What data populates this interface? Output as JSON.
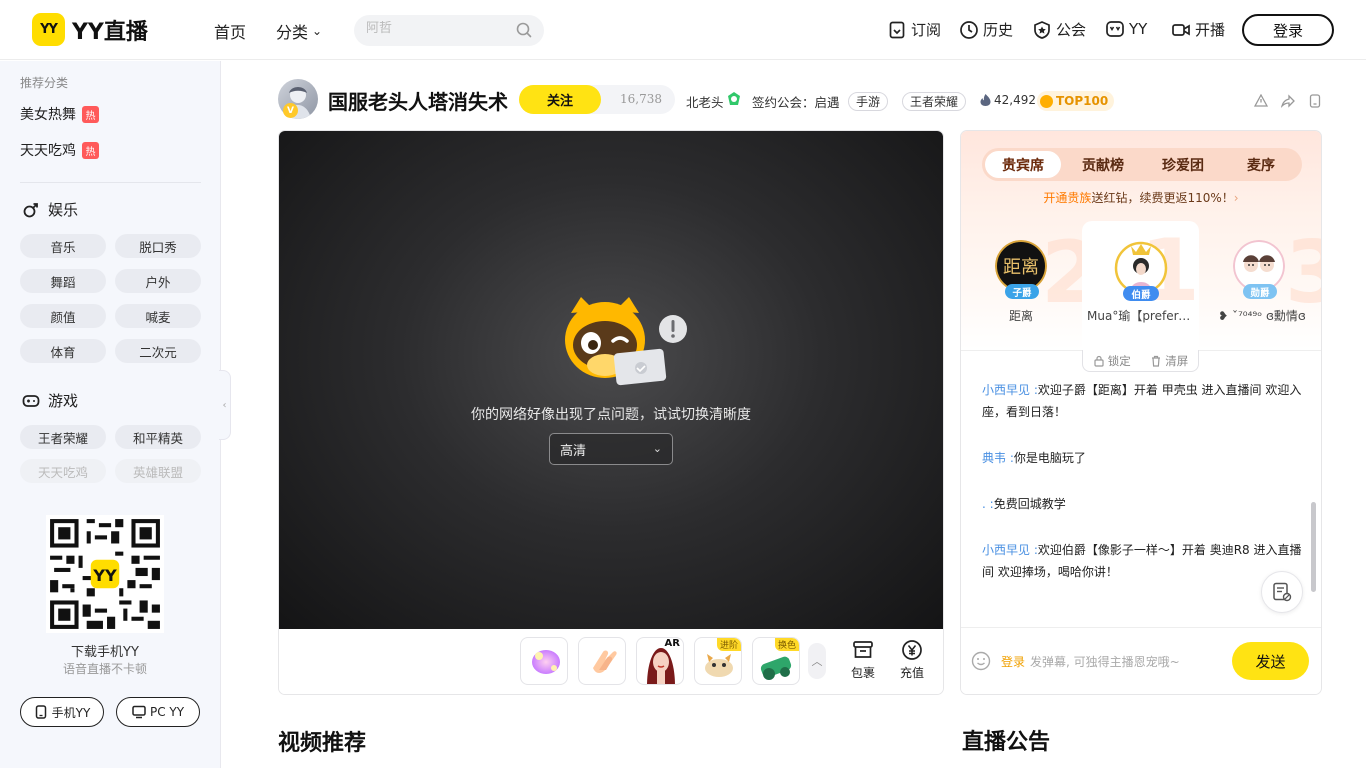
{
  "header": {
    "logo_badge": "YY",
    "logo_text": "YY直播",
    "nav_home": "首页",
    "nav_category": "分类",
    "search_placeholder": "阿哲",
    "right_nav": [
      {
        "label": "订阅",
        "icon": "bookmark-icon"
      },
      {
        "label": "历史",
        "icon": "clock-icon"
      },
      {
        "label": "公会",
        "icon": "star-badge-icon"
      },
      {
        "label": "YY",
        "icon": "yy-face-icon"
      },
      {
        "label": "开播",
        "icon": "video-camera-icon"
      }
    ],
    "login_label": "登录"
  },
  "sidebar": {
    "recommend_title": "推荐分类",
    "hot_items": [
      {
        "label": "美女热舞",
        "tag": "热"
      },
      {
        "label": "天天吃鸡",
        "tag": "热"
      }
    ],
    "sections": [
      {
        "title": "娱乐",
        "icon": "gender-male-icon",
        "chips": [
          "音乐",
          "脱口秀",
          "舞蹈",
          "户外",
          "颜值",
          "喊麦",
          "体育",
          "二次元"
        ]
      },
      {
        "title": "游戏",
        "icon": "gamepad-icon",
        "chips": [
          "王者荣耀",
          "和平精英",
          "天天吃鸡",
          "英雄联盟"
        ]
      }
    ],
    "qr_label": "下载手机YY",
    "qr_sub": "语音直播不卡顿",
    "download_buttons": [
      {
        "label": "手机YY",
        "icon": "phone-icon"
      },
      {
        "label": "PC YY",
        "icon": "monitor-icon"
      }
    ]
  },
  "room": {
    "avatar_badge": "V",
    "title": "国服老头人塔消失术",
    "follow_label": "关注",
    "follow_count": "16,738",
    "host_name": "北老头",
    "guild": "签约公会：启遇",
    "tags": [
      "手游",
      "王者荣耀"
    ],
    "heat": "42,492",
    "rank_badge": "TOP100"
  },
  "player": {
    "error_message": "你的网络好像出现了点问题，试试切换清晰度",
    "quality": "高清",
    "gifts": [
      {
        "name": "pink-flower-gift",
        "badge": ""
      },
      {
        "name": "clap-gift",
        "badge": ""
      },
      {
        "name": "ar-girl-gift",
        "badge": "AR"
      },
      {
        "name": "cat-gift",
        "badge": "进阶"
      },
      {
        "name": "cannon-gift",
        "badge": "换色"
      }
    ],
    "bag_label": "包裹",
    "recharge_label": "充值"
  },
  "right_panel": {
    "tabs": [
      "贵宾席",
      "贡献榜",
      "珍爱团",
      "麦序"
    ],
    "active_tab": 0,
    "promo_highlight": "开通贵族",
    "promo_rest": "送红钻，续费更返110%！",
    "vips": [
      {
        "rank": "2",
        "name": "距离",
        "badge": "子爵",
        "badge_color": "#3aa3e8"
      },
      {
        "rank": "1",
        "name": "Mua°瑜【prefere…",
        "badge": "伯爵",
        "badge_color": "#3f8cf0"
      },
      {
        "rank": "3",
        "name": "❥ ˇ⁷⁰⁴⁹ᵒ ɞ勳情ɞ",
        "badge": "勋爵",
        "badge_color": "#7ec3f2"
      }
    ],
    "lock_label": "锁定",
    "clear_label": "清屏",
    "messages": [
      {
        "user": "小西早见",
        "text": "欢迎子爵【距离】开着 甲壳虫 进入直播间 欢迎入座，看到日落！"
      },
      {
        "user": "典韦",
        "text": "你是电脑玩了"
      },
      {
        "user": ".",
        "text": "免费回城教学"
      },
      {
        "user": "小西早见",
        "text": "欢迎伯爵【像影子一样～】开着 奥迪R8 进入直播间 欢迎捧场，喝哈你讲！"
      }
    ],
    "input_login": "登录",
    "input_placeholder": "发弹幕, 可独得主播恩宠哦~",
    "send_label": "发送"
  },
  "bottom": {
    "video_rec_title": "视频推荐",
    "notice_title": "直播公告"
  },
  "colors": {
    "brand_yellow": "#ffe313",
    "hot_red": "#ff5a5a",
    "chat_user_blue": "#4a90e2"
  }
}
